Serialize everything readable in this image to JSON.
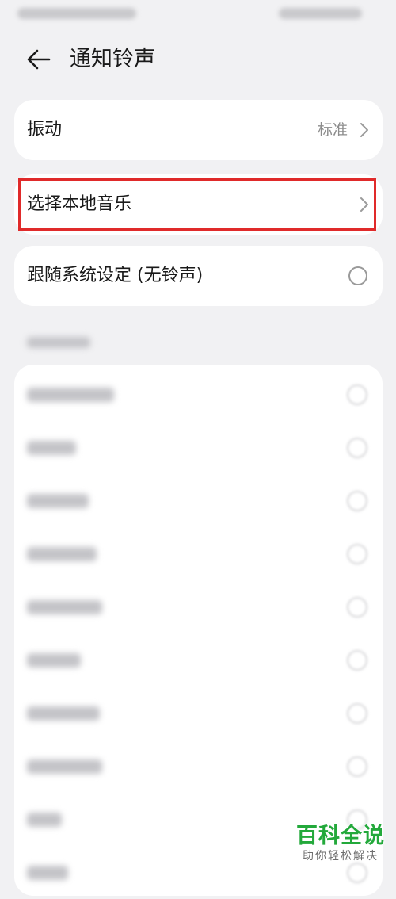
{
  "status_bar": {
    "left_text": "",
    "right_text": ""
  },
  "header": {
    "title": "通知铃声"
  },
  "vibration": {
    "label": "振动",
    "value": "标准"
  },
  "local_music": {
    "label": "选择本地音乐"
  },
  "follow_system": {
    "label": "跟随系统设定 (无铃声)",
    "selected": false
  },
  "preset_section": {
    "title": "",
    "items": [
      {
        "label": "",
        "selected": false
      },
      {
        "label": "",
        "selected": false
      },
      {
        "label": "",
        "selected": false
      },
      {
        "label": "",
        "selected": false
      },
      {
        "label": "",
        "selected": false
      },
      {
        "label": "",
        "selected": false
      },
      {
        "label": "",
        "selected": false
      },
      {
        "label": "",
        "selected": false
      },
      {
        "label": "",
        "selected": false
      },
      {
        "label": "",
        "selected": false
      }
    ]
  },
  "watermark": {
    "title": "百科全说",
    "subtitle": "助你轻松解决"
  },
  "colors": {
    "background": "#f1f1f3",
    "card": "#ffffff",
    "highlight": "#e02a2a",
    "watermark_green": "#23a93b"
  }
}
